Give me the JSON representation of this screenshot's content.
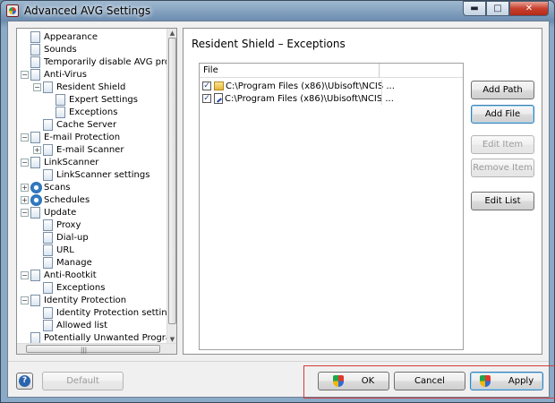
{
  "window": {
    "title": "Advanced AVG Settings",
    "buttons": {
      "minimize": "▬",
      "maximize": "□",
      "close": "✕"
    }
  },
  "tree": {
    "items": [
      {
        "label": "Appearance",
        "level": 0,
        "expander": "",
        "icon": "doc-icon"
      },
      {
        "label": "Sounds",
        "level": 0,
        "expander": "",
        "icon": "doc-icon"
      },
      {
        "label": "Temporarily disable AVG protect",
        "level": 0,
        "expander": "",
        "icon": "doc-icon"
      },
      {
        "label": "Anti-Virus",
        "level": 0,
        "expander": "−",
        "icon": "doc-icon"
      },
      {
        "label": "Resident Shield",
        "level": 1,
        "expander": "−",
        "icon": "doc-icon"
      },
      {
        "label": "Expert Settings",
        "level": 2,
        "expander": "",
        "icon": "doc-icon"
      },
      {
        "label": "Exceptions",
        "level": 2,
        "expander": "",
        "icon": "doc-icon"
      },
      {
        "label": "Cache Server",
        "level": 1,
        "expander": "",
        "icon": "doc-icon"
      },
      {
        "label": "E-mail Protection",
        "level": 0,
        "expander": "−",
        "icon": "doc-icon"
      },
      {
        "label": "E-mail Scanner",
        "level": 1,
        "expander": "+",
        "icon": "doc-icon"
      },
      {
        "label": "LinkScanner",
        "level": 0,
        "expander": "−",
        "icon": "doc-icon"
      },
      {
        "label": "LinkScanner settings",
        "level": 1,
        "expander": "",
        "icon": "doc-icon"
      },
      {
        "label": "Scans",
        "level": 0,
        "expander": "+",
        "icon": "cog-icon"
      },
      {
        "label": "Schedules",
        "level": 0,
        "expander": "+",
        "icon": "cog-icon"
      },
      {
        "label": "Update",
        "level": 0,
        "expander": "−",
        "icon": "doc-icon"
      },
      {
        "label": "Proxy",
        "level": 1,
        "expander": "",
        "icon": "doc-icon"
      },
      {
        "label": "Dial-up",
        "level": 1,
        "expander": "",
        "icon": "doc-icon"
      },
      {
        "label": "URL",
        "level": 1,
        "expander": "",
        "icon": "doc-icon"
      },
      {
        "label": "Manage",
        "level": 1,
        "expander": "",
        "icon": "doc-icon"
      },
      {
        "label": "Anti-Rootkit",
        "level": 0,
        "expander": "−",
        "icon": "doc-icon"
      },
      {
        "label": "Exceptions",
        "level": 1,
        "expander": "",
        "icon": "doc-icon"
      },
      {
        "label": "Identity Protection",
        "level": 0,
        "expander": "−",
        "icon": "doc-icon"
      },
      {
        "label": "Identity Protection settings",
        "level": 1,
        "expander": "",
        "icon": "doc-icon"
      },
      {
        "label": "Allowed list",
        "level": 1,
        "expander": "",
        "icon": "doc-icon"
      },
      {
        "label": "Potentially Unwanted Programs",
        "level": 0,
        "expander": "",
        "icon": "doc-icon"
      }
    ],
    "hscroll_grip": "|||"
  },
  "panel": {
    "title": "Resident Shield – Exceptions",
    "column_header": "File",
    "rows": [
      {
        "checked": "✓",
        "icon": "folder-icon",
        "path": "C:\\Program Files (x86)\\Ubisoft\\NCIS ..."
      },
      {
        "checked": "✓",
        "icon": "file-icon",
        "path": "C:\\Program Files (x86)\\Ubisoft\\NCIS ..."
      }
    ]
  },
  "side_buttons": {
    "add_path": "Add Path",
    "add_file": "Add File",
    "edit_item": "Edit Item",
    "remove_item": "Remove Item",
    "edit_list": "Edit List"
  },
  "bottom": {
    "help": "?",
    "default": "Default",
    "ok": "OK",
    "cancel": "Cancel",
    "apply": "Apply"
  }
}
